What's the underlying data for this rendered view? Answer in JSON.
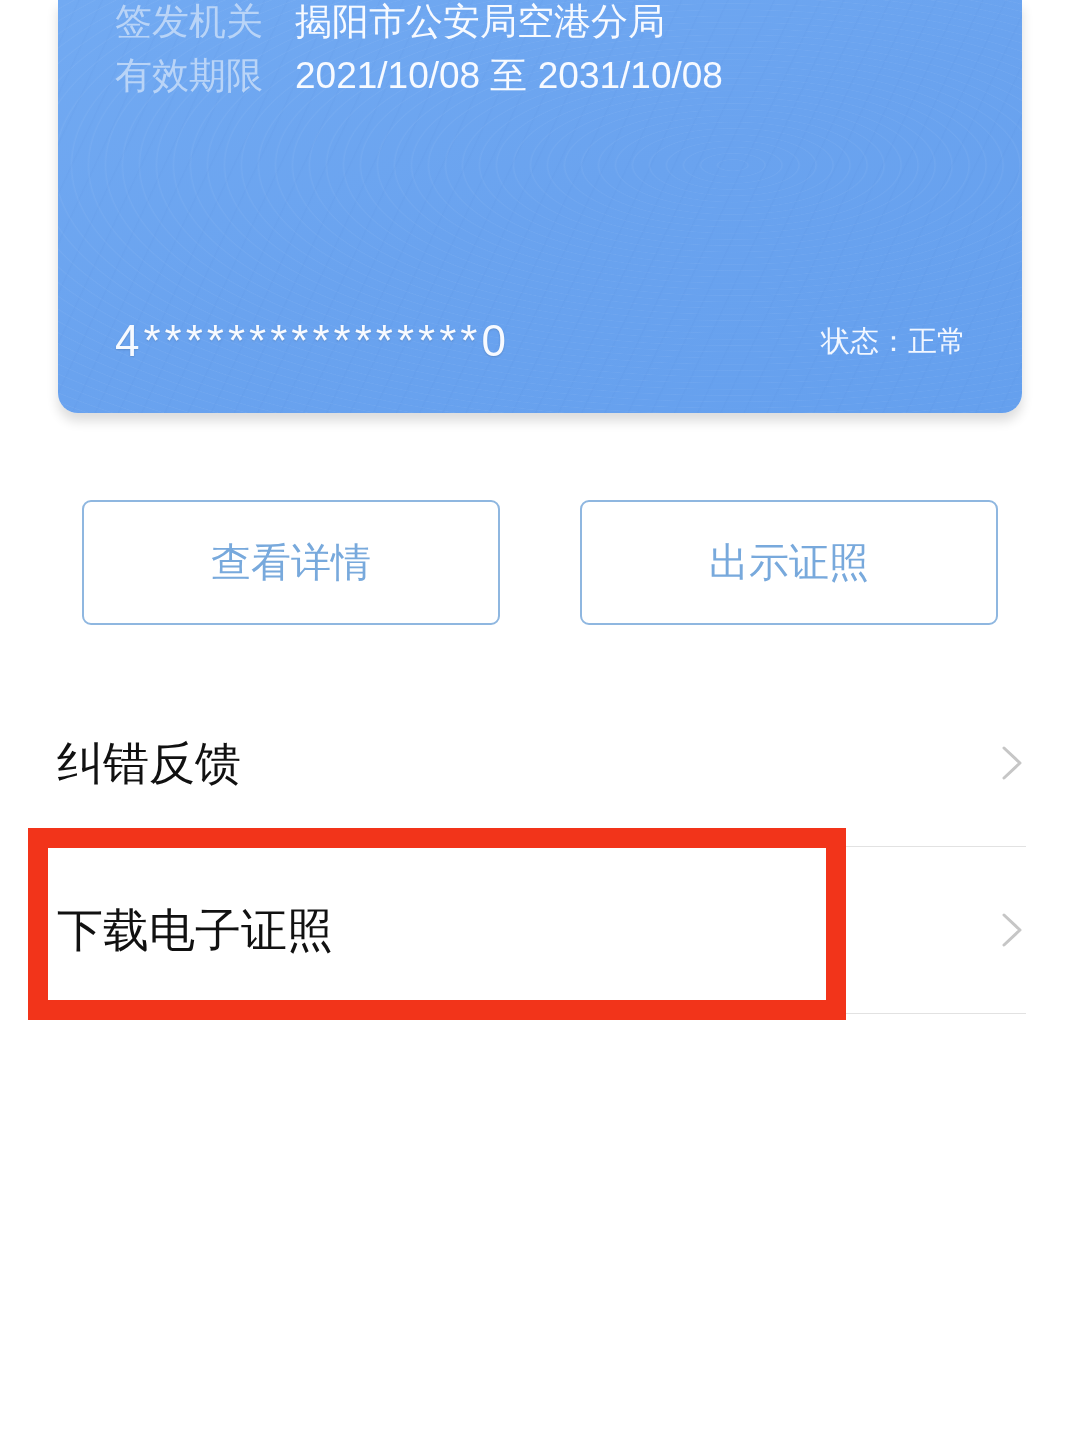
{
  "id_card": {
    "fields": [
      {
        "label": "签发机关",
        "value": "揭阳市公安局空港分局"
      },
      {
        "label": "有效期限",
        "value": "2021/10/08 至 2031/10/08"
      }
    ],
    "number": "4****************0",
    "status": "状态：正常"
  },
  "buttons": [
    {
      "label": "查看详情"
    },
    {
      "label": "出示证照"
    }
  ],
  "menu": [
    {
      "label": "纠错反馈",
      "highlighted": false
    },
    {
      "label": "下载电子证照",
      "highlighted": true
    }
  ]
}
